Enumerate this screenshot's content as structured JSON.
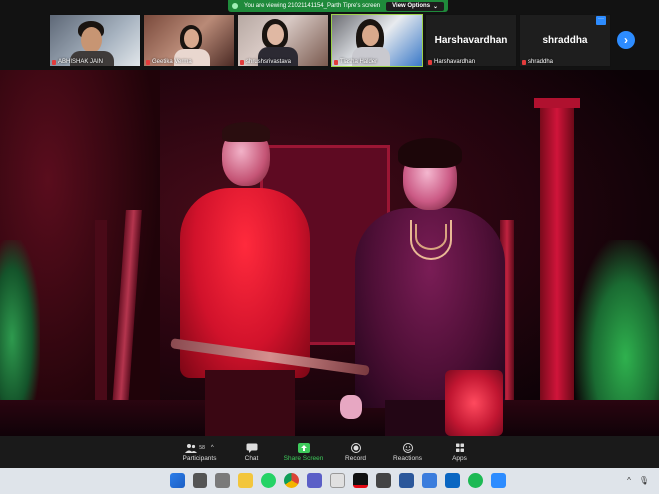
{
  "banner": {
    "text": "You are viewing 21021141154_Parth Tipre's screen",
    "view_options": "View Options",
    "chevron": "⌄"
  },
  "gallery": {
    "tiles": [
      {
        "name": "ABHISHAK JAIN",
        "type": "video"
      },
      {
        "name": "Geetika Verma",
        "type": "video"
      },
      {
        "name": "shrushsrivastava",
        "type": "video"
      },
      {
        "name": "Tiasha Halder",
        "type": "video"
      },
      {
        "name": "Harshavardhan",
        "display": "Harshavardhan",
        "type": "name"
      },
      {
        "name": "shraddha",
        "display": "shraddha",
        "type": "name"
      }
    ],
    "next_glyph": "›",
    "more_glyph": "···"
  },
  "toolbar": {
    "participants_label": "Participants",
    "participants_count": "58",
    "chat_label": "Chat",
    "share_label": "Share Screen",
    "record_label": "Record",
    "reactions_label": "Reactions",
    "apps_label": "Apps",
    "caret": "^"
  },
  "taskbar": {
    "tray_up": "^",
    "tray_mic": "🎙"
  },
  "colors": {
    "share_green": "#3ecb5c",
    "accent_blue": "#2d8cff",
    "mic_red": "#e23b3b"
  }
}
